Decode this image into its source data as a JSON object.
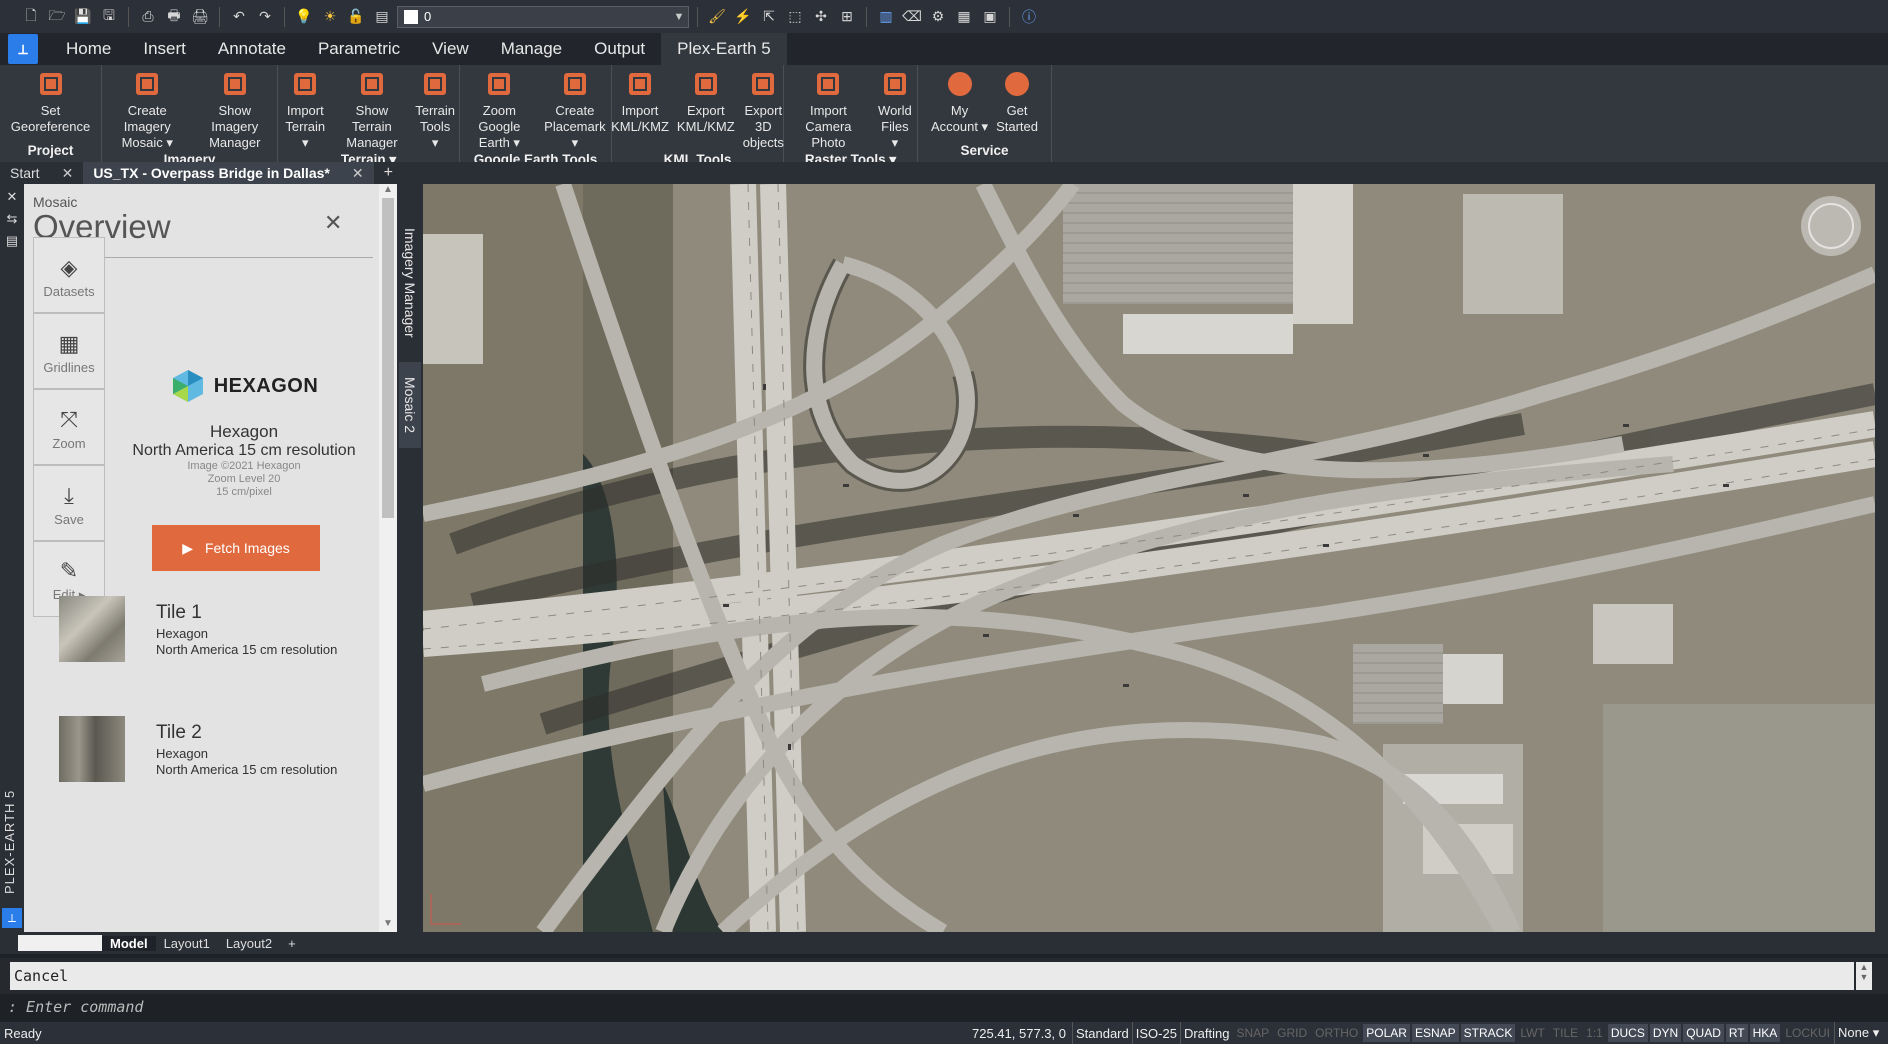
{
  "qat": {
    "layer_value": "0"
  },
  "tabs": [
    "Home",
    "Insert",
    "Annotate",
    "Parametric",
    "View",
    "Manage",
    "Output",
    "Plex-Earth 5"
  ],
  "active_tab_index": 7,
  "ribbon": {
    "groups": [
      {
        "label": "Project",
        "buttons": [
          "Set\nGeoreference"
        ]
      },
      {
        "label": "Imagery",
        "buttons": [
          "Create Imagery\nMosaic ▾",
          "Show Imagery\nManager"
        ]
      },
      {
        "label": "Terrain ▾",
        "buttons": [
          "Import\nTerrain ▾",
          "Show Terrain\nManager",
          "Terrain\nTools ▾"
        ]
      },
      {
        "label": "Google Earth Tools",
        "buttons": [
          "Zoom Google\nEarth ▾",
          "Create\nPlacemark ▾"
        ]
      },
      {
        "label": "KML Tools",
        "buttons": [
          "Import\nKML/KMZ",
          "Export\nKML/KMZ",
          "Export 3D\nobjects"
        ]
      },
      {
        "label": "Raster Tools ▾",
        "buttons": [
          "Import\nCamera Photo",
          "World\nFiles ▾"
        ]
      },
      {
        "label": "Service",
        "buttons": [
          "My\nAccount ▾",
          "Get\nStarted"
        ]
      }
    ],
    "accent": "#e06a3e"
  },
  "doc_tabs": {
    "start": "Start",
    "active": "US_TX - Overpass Bridge in Dallas*",
    "close": "✕",
    "add": "+"
  },
  "left_strip": {
    "vertical_label": "PLEX-EARTH 5"
  },
  "panel": {
    "caption": "Mosaic",
    "title": "Overview",
    "close": "✕",
    "tools": [
      {
        "label": "Datasets",
        "icon": "layers-icon"
      },
      {
        "label": "Gridlines",
        "icon": "grid-icon"
      },
      {
        "label": "Zoom",
        "icon": "zoom-extents-icon"
      },
      {
        "label": "Save",
        "icon": "download-icon"
      },
      {
        "label": "Edit ▸",
        "icon": "pencil-icon"
      }
    ],
    "provider": {
      "logo_text": "HEXAGON",
      "name": "Hexagon",
      "resolution": "North America 15 cm resolution",
      "copyright": "Image ©2021 Hexagon",
      "zoom": "Zoom Level 20",
      "pixel": "15 cm/pixel"
    },
    "fetch_label": "Fetch Images",
    "tiles": [
      {
        "title": "Tile 1",
        "provider": "Hexagon",
        "resolution": "North America 15 cm resolution"
      },
      {
        "title": "Tile 2",
        "provider": "Hexagon",
        "resolution": "North America 15 cm resolution"
      }
    ]
  },
  "side_tabs": [
    "Imagery Manager",
    "Mosaic 2"
  ],
  "layout_tabs": [
    "Model",
    "Layout1",
    "Layout2",
    "+"
  ],
  "command": {
    "history": "Cancel",
    "prompt": ": Enter command"
  },
  "status": {
    "ready": "Ready",
    "coords": "725.41, 577.3, 0",
    "items": [
      "Standard",
      "ISO-25",
      "Drafting"
    ],
    "toggles": [
      {
        "label": "SNAP",
        "on": false
      },
      {
        "label": "GRID",
        "on": false
      },
      {
        "label": "ORTHO",
        "on": false
      },
      {
        "label": "POLAR",
        "on": true
      },
      {
        "label": "ESNAP",
        "on": true
      },
      {
        "label": "STRACK",
        "on": true
      },
      {
        "label": "LWT",
        "on": false
      },
      {
        "label": "TILE",
        "on": false
      },
      {
        "label": "1:1",
        "on": false
      },
      {
        "label": "DUCS",
        "on": true
      },
      {
        "label": "DYN",
        "on": true
      },
      {
        "label": "QUAD",
        "on": true
      },
      {
        "label": "RT",
        "on": true
      },
      {
        "label": "HKA",
        "on": true
      },
      {
        "label": "LOCKUI",
        "on": false
      }
    ],
    "last": "None ▾"
  }
}
